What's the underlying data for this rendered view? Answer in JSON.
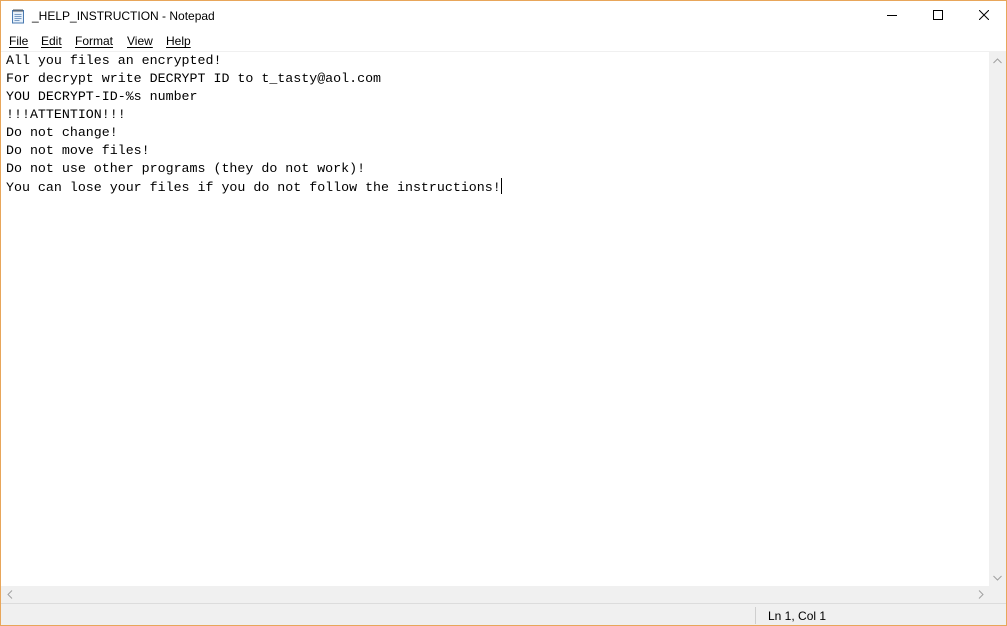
{
  "window": {
    "title": "_HELP_INSTRUCTION - Notepad",
    "accent_border": "#e8a65a"
  },
  "menu": {
    "items": [
      {
        "label": "File",
        "name": "menu-file"
      },
      {
        "label": "Edit",
        "name": "menu-edit"
      },
      {
        "label": "Format",
        "name": "menu-format"
      },
      {
        "label": "View",
        "name": "menu-view"
      },
      {
        "label": "Help",
        "name": "menu-help"
      }
    ]
  },
  "editor": {
    "lines": [
      "All you files an encrypted!",
      "For decrypt write DECRYPT ID to t_tasty@aol.com",
      "YOU DECRYPT-ID-%s number",
      "!!!ATTENTION!!!",
      "Do not change!",
      "Do not move files!",
      "Do not use other programs (they do not work)!",
      "You can lose your files if you do not follow the instructions!"
    ]
  },
  "status": {
    "position": "Ln 1, Col 1"
  },
  "icons": {
    "app": "notepad-icon",
    "minimize": "minimize-icon",
    "maximize": "maximize-icon",
    "close": "close-icon"
  }
}
